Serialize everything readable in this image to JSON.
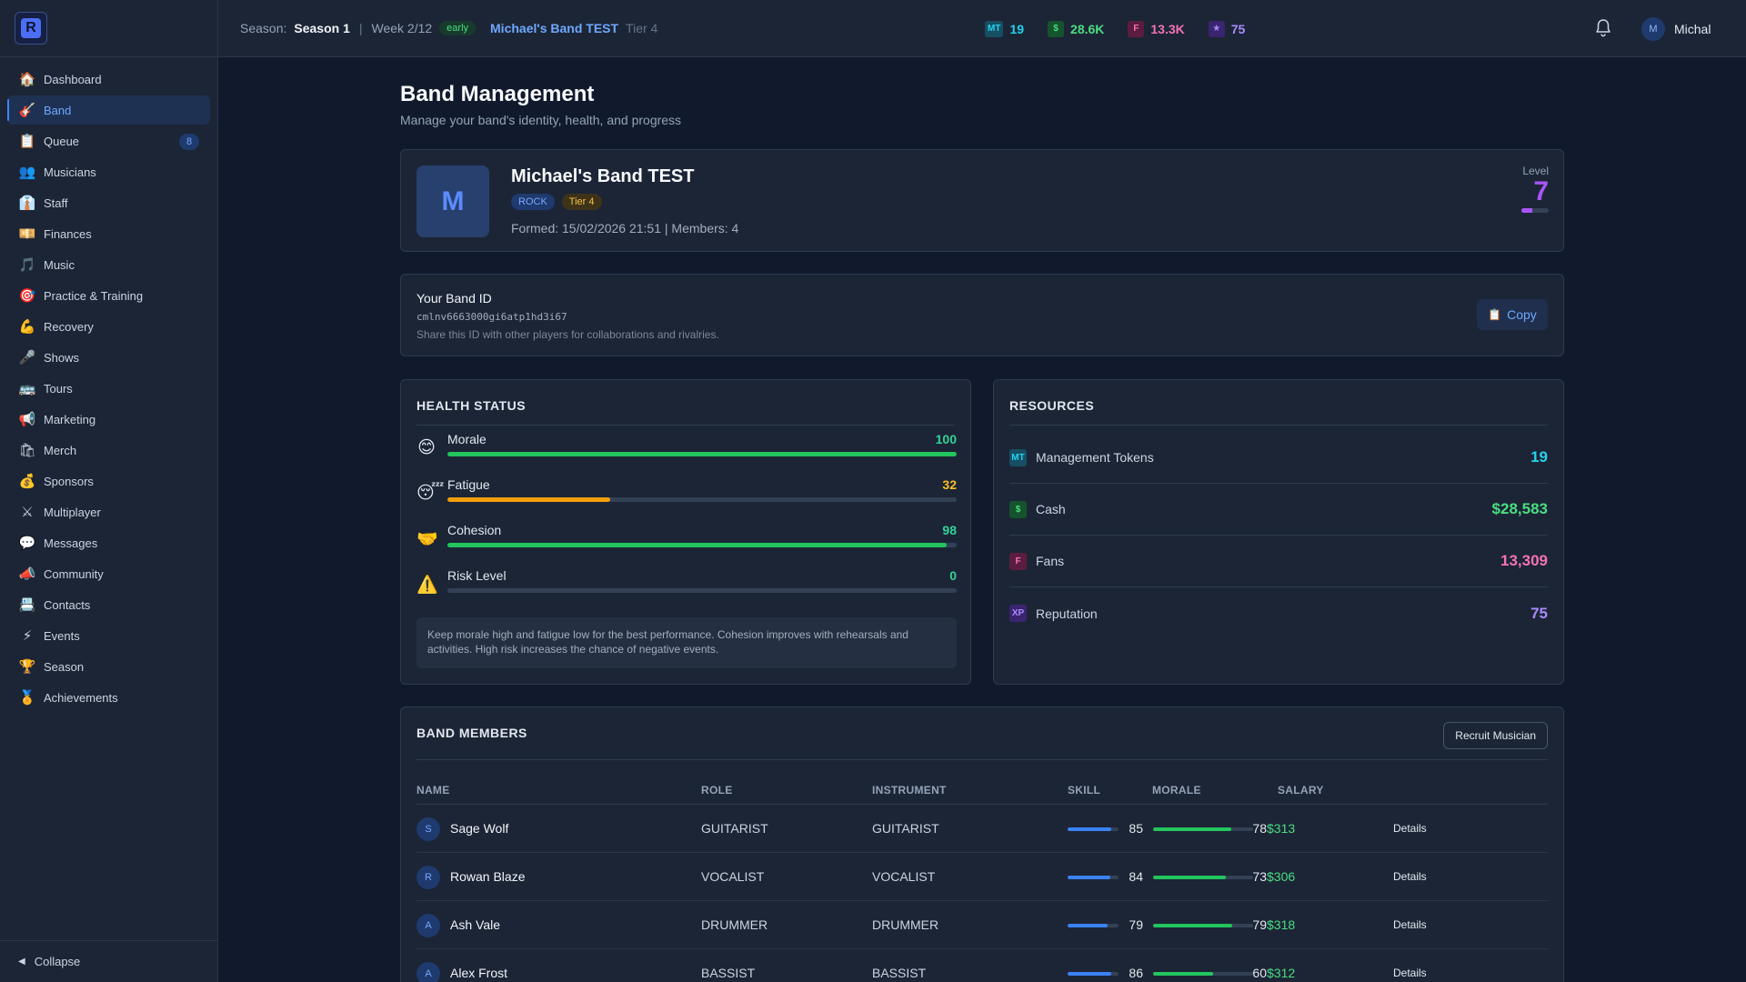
{
  "sidebar": {
    "items": [
      {
        "label": "Dashboard",
        "icon": "🏠",
        "icon_name": "house-icon",
        "active": false
      },
      {
        "label": "Band",
        "icon": "🎸",
        "icon_name": "guitar-icon",
        "active": true
      },
      {
        "label": "Queue",
        "icon": "📋",
        "icon_name": "clipboard-icon",
        "active": false,
        "badge": "8"
      },
      {
        "label": "Musicians",
        "icon": "👥",
        "icon_name": "people-icon",
        "active": false
      },
      {
        "label": "Staff",
        "icon": "👔",
        "icon_name": "necktie-icon",
        "active": false
      },
      {
        "label": "Finances",
        "icon": "💴",
        "icon_name": "banknote-icon",
        "active": false
      },
      {
        "label": "Music",
        "icon": "🎵",
        "icon_name": "music-note-icon",
        "active": false
      },
      {
        "label": "Practice & Training",
        "icon": "🎯",
        "icon_name": "target-icon",
        "active": false
      },
      {
        "label": "Recovery",
        "icon": "💪",
        "icon_name": "flexed-arm-icon",
        "active": false
      },
      {
        "label": "Shows",
        "icon": "🎤",
        "icon_name": "microphone-icon",
        "active": false
      },
      {
        "label": "Tours",
        "icon": "🚌",
        "icon_name": "bus-icon",
        "active": false
      },
      {
        "label": "Marketing",
        "icon": "📢",
        "icon_name": "megaphone-icon",
        "active": false
      },
      {
        "label": "Merch",
        "icon": "🛍",
        "icon_name": "shopping-bag-icon",
        "active": false
      },
      {
        "label": "Sponsors",
        "icon": "💰",
        "icon_name": "money-bag-icon",
        "active": false
      },
      {
        "label": "Multiplayer",
        "icon": "⚔",
        "icon_name": "crossed-swords-icon",
        "active": false
      },
      {
        "label": "Messages",
        "icon": "💬",
        "icon_name": "speech-bubble-icon",
        "active": false
      },
      {
        "label": "Community",
        "icon": "📣",
        "icon_name": "loudspeaker-icon",
        "active": false
      },
      {
        "label": "Contacts",
        "icon": "📇",
        "icon_name": "card-index-icon",
        "active": false
      },
      {
        "label": "Events",
        "icon": "⚡",
        "icon_name": "lightning-icon",
        "active": false
      },
      {
        "label": "Season",
        "icon": "🏆",
        "icon_name": "trophy-icon",
        "active": false
      },
      {
        "label": "Achievements",
        "icon": "🏅",
        "icon_name": "medal-icon",
        "active": false
      }
    ],
    "collapse_label": "Collapse"
  },
  "topbar": {
    "season_label": "Season:",
    "season_value": "Season 1",
    "divider": "|",
    "week": "Week 2/12",
    "phase": "early",
    "band_name": "Michael's Band TEST",
    "tier": "Tier 4",
    "stats": [
      {
        "icon": "MT",
        "value": "19",
        "color": "#22d3ee",
        "bg": "#164e63"
      },
      {
        "icon": "$",
        "value": "28.6K",
        "color": "#4ade80",
        "bg": "#14532d"
      },
      {
        "icon": "F",
        "value": "13.3K",
        "color": "#f472b6",
        "bg": "#5b1d3f"
      },
      {
        "icon": "★",
        "value": "75",
        "color": "#a78bfa",
        "bg": "#3b2470"
      }
    ],
    "user_initial": "M",
    "user_name": "Michal"
  },
  "page": {
    "title": "Band Management",
    "subtitle": "Manage your band's identity, health, and progress"
  },
  "band": {
    "initial": "M",
    "name": "Michael's Band TEST",
    "genre": "ROCK",
    "tier": "Tier 4",
    "formed": "Formed: 15/02/2026 21:51 | Members: 4",
    "level_label": "Level",
    "level": "7",
    "level_progress": 0.4
  },
  "band_id": {
    "title": "Your Band ID",
    "value": "cmlnv6663000gi6atp1hd3i67",
    "note": "Share this ID with other players for collaborations and rivalries.",
    "copy_label": "Copy"
  },
  "health": {
    "title": "HEALTH STATUS",
    "metrics": [
      {
        "label": "Morale",
        "value": "100",
        "icon": "😊",
        "icon_name": "smiling-face-icon",
        "color": "#22c55e",
        "text_color": "#34d399"
      },
      {
        "label": "Fatigue",
        "value": "32",
        "icon": "😴",
        "icon_name": "sleepy-face-icon",
        "color": "#f59e0b",
        "text_color": "#fbbf24"
      },
      {
        "label": "Cohesion",
        "value": "98",
        "icon": "🤝",
        "icon_name": "handshake-icon",
        "color": "#22c55e",
        "text_color": "#34d399"
      },
      {
        "label": "Risk Level",
        "value": "0",
        "icon": "⚠️",
        "icon_name": "warning-icon",
        "color": "#22c55e",
        "text_color": "#34d399"
      }
    ],
    "note": "Keep morale high and fatigue low for the best performance. Cohesion improves with rehearsals and activities. High risk increases the chance of negative events."
  },
  "resources": {
    "title": "RESOURCES",
    "items": [
      {
        "icon": "MT",
        "label": "Management Tokens",
        "value": "19",
        "color": "#22d3ee",
        "bg": "#164e63"
      },
      {
        "icon": "$",
        "label": "Cash",
        "value": "$28,583",
        "color": "#4ade80",
        "bg": "#14532d"
      },
      {
        "icon": "F",
        "label": "Fans",
        "value": "13,309",
        "color": "#f472b6",
        "bg": "#5b1d3f"
      },
      {
        "icon": "XP",
        "label": "Reputation",
        "value": "75",
        "color": "#a78bfa",
        "bg": "#3b2470"
      }
    ]
  },
  "members": {
    "title": "BAND MEMBERS",
    "recruit_label": "Recruit Musician",
    "headers": {
      "name": "NAME",
      "role": "ROLE",
      "instrument": "INSTRUMENT",
      "skill": "SKILL",
      "morale": "MORALE",
      "salary": "SALARY"
    },
    "details_label": "Details",
    "rows": [
      {
        "initial": "S",
        "name": "Sage Wolf",
        "role": "GUITARIST",
        "instrument": "GUITARIST",
        "skill": 85,
        "morale": 78,
        "salary": "$313"
      },
      {
        "initial": "R",
        "name": "Rowan Blaze",
        "role": "VOCALIST",
        "instrument": "VOCALIST",
        "skill": 84,
        "morale": 73,
        "salary": "$306"
      },
      {
        "initial": "A",
        "name": "Ash Vale",
        "role": "DRUMMER",
        "instrument": "DRUMMER",
        "skill": 79,
        "morale": 79,
        "salary": "$318"
      },
      {
        "initial": "A",
        "name": "Alex Frost",
        "role": "BASSIST",
        "instrument": "BASSIST",
        "skill": 86,
        "morale": 60,
        "salary": "$312"
      }
    ]
  }
}
